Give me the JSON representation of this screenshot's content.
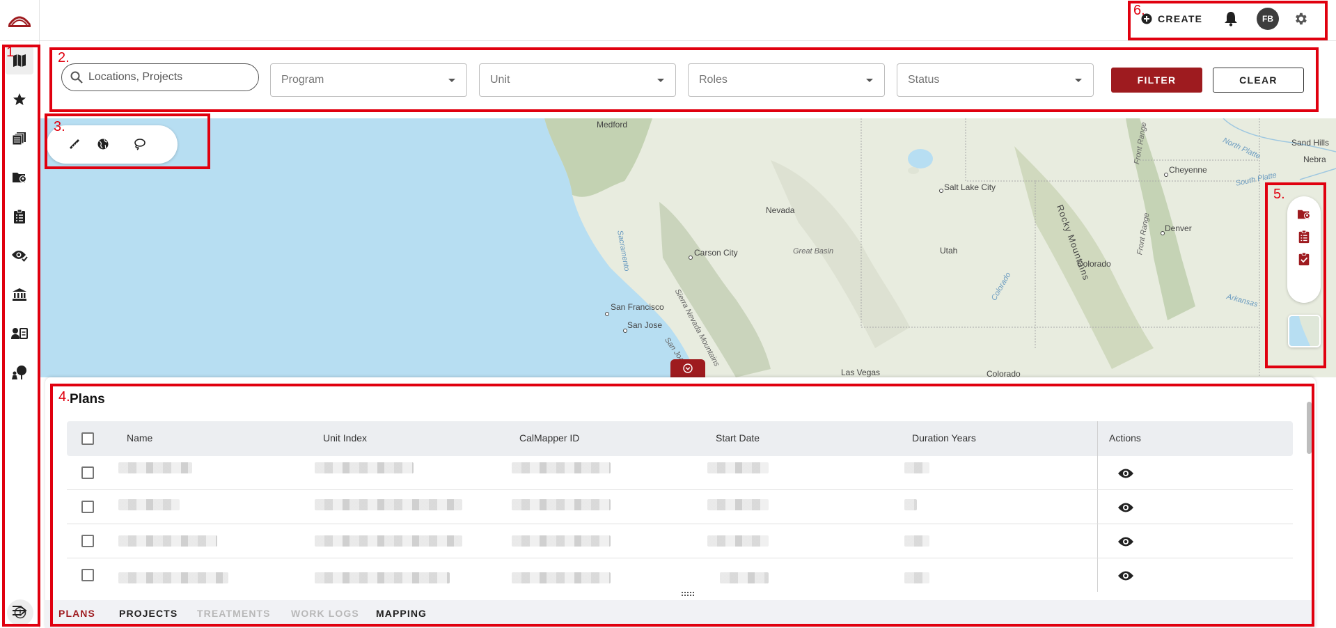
{
  "topbar": {
    "create_label": "CREATE",
    "avatar_initials": "FB"
  },
  "sidebar": {
    "items": [
      {
        "icon": "map-icon",
        "active": true
      },
      {
        "icon": "star-icon"
      },
      {
        "icon": "stacked-documents-icon"
      },
      {
        "icon": "folder-location-icon"
      },
      {
        "icon": "clipboard-list-icon"
      },
      {
        "icon": "eye-check-icon"
      },
      {
        "icon": "bank-icon"
      },
      {
        "icon": "contact-card-icon"
      },
      {
        "icon": "tree-person-icon"
      }
    ],
    "bottom": [
      {
        "icon": "info-icon"
      },
      {
        "icon": "expand-arrow-icon"
      }
    ]
  },
  "filters": {
    "search_placeholder": "Locations, Projects",
    "program": "Program",
    "unit": "Unit",
    "roles": "Roles",
    "status": "Status",
    "filter_label": "FILTER",
    "clear_label": "CLEAR"
  },
  "map": {
    "tools": [
      "ruler-icon",
      "globe-icon",
      "lasso-icon"
    ],
    "layers": [
      "folder-location-icon",
      "clipboard-list-icon",
      "clipboard-check-icon"
    ],
    "labels": {
      "medford": "Medford",
      "nevada": "Nevada",
      "salt_lake_city": "Salt Lake City",
      "carson_city": "Carson City",
      "great_basin": "Great Basin",
      "utah": "Utah",
      "san_francisco": "San Francisco",
      "san_jose": "San Jose",
      "sierra_nevada": "Sierra Nevada Mountains",
      "san_joaquin": "San Joaquin",
      "sacramento": "Sacramento",
      "las_vegas": "Las Vegas",
      "colorado_river": "Colorado",
      "colorado_state": "Colorado",
      "denver": "Denver",
      "cheyenne": "Cheyenne",
      "rocky_mountains": "Rocky Mountains",
      "front_range": "Front Range",
      "front_range_2": "Front Range",
      "north_platte": "North Platte",
      "south_platte": "South Platte",
      "arkansas": "Arkansas",
      "sand_hills": "Sand Hills",
      "nebr": "Nebra",
      "colorado_lower": "Colorado"
    }
  },
  "plans": {
    "title": "Plans",
    "columns": [
      "Name",
      "Unit Index",
      "CalMapper ID",
      "Start Date",
      "Duration Years",
      "Actions"
    ],
    "row_count": 4
  },
  "tabs": [
    {
      "label": "PLANS",
      "state": "active"
    },
    {
      "label": "PROJECTS",
      "state": "enabled"
    },
    {
      "label": "TREATMENTS",
      "state": "disabled"
    },
    {
      "label": "WORK LOGS",
      "state": "disabled"
    },
    {
      "label": "MAPPING",
      "state": "enabled"
    }
  ],
  "annotations": [
    "1",
    "2.",
    "3.",
    "4.",
    "5.",
    "6."
  ],
  "colors": {
    "brand_red": "#9e1b1f",
    "annotation_red": "#e0000f",
    "water": "#b7def2"
  }
}
